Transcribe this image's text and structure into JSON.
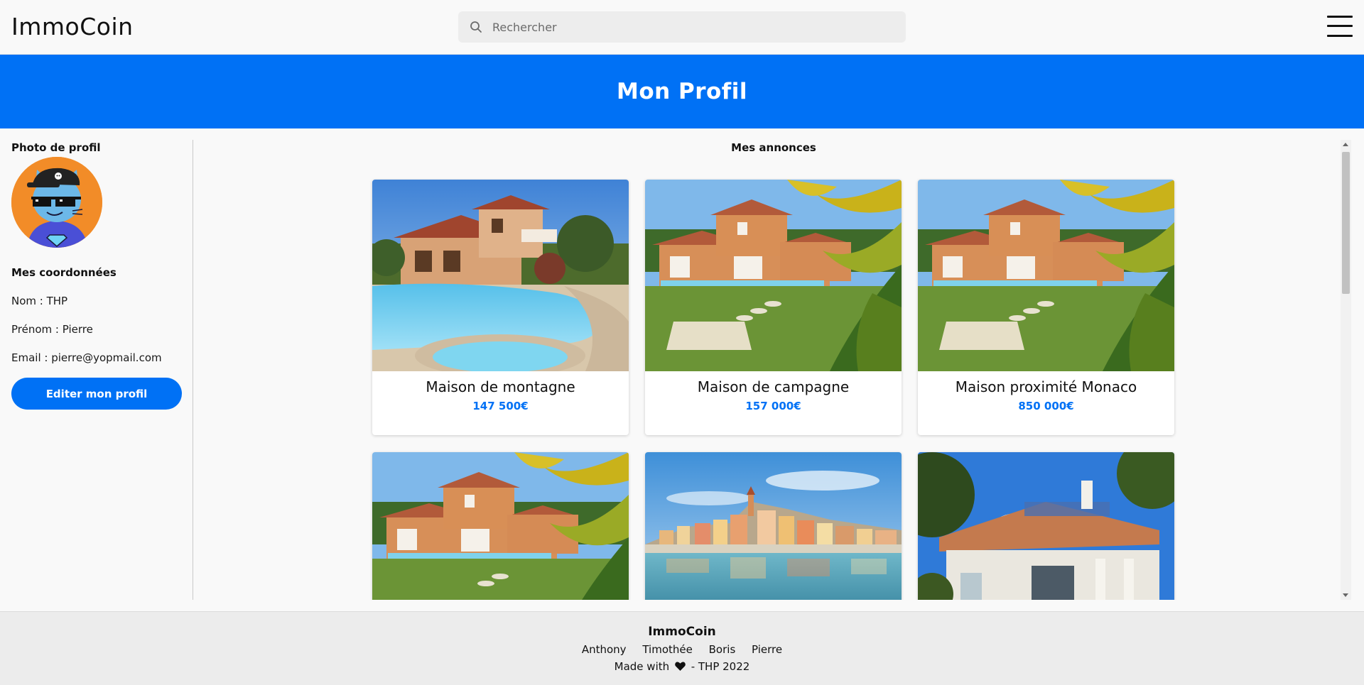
{
  "header": {
    "brand": "ImmoCoin",
    "search_placeholder": "Rechercher",
    "menu_icon": "hamburger-menu-icon"
  },
  "banner": {
    "title": "Mon Profil"
  },
  "sidebar": {
    "photo_heading": "Photo de profil",
    "coords_heading": "Mes coordonnées",
    "nom": "Nom : THP",
    "prenom": "Prénom : Pierre",
    "email": "Email : pierre@yopmail.com",
    "edit_button": "Editer mon profil"
  },
  "main": {
    "title": "Mes annonces",
    "listings": [
      {
        "title": "Maison de montagne",
        "price": "147 500€",
        "image": "villa-pool"
      },
      {
        "title": "Maison de campagne",
        "price": "157 000€",
        "image": "house-garden-palm"
      },
      {
        "title": "Maison proximité Monaco",
        "price": "850 000€",
        "image": "house-garden-palm"
      },
      {
        "title": "",
        "price": "",
        "image": "house-garden-palm"
      },
      {
        "title": "",
        "price": "",
        "image": "coastal-town"
      },
      {
        "title": "",
        "price": "",
        "image": "white-house-terrace"
      }
    ]
  },
  "footer": {
    "brand": "ImmoCoin",
    "authors": [
      "Anthony",
      "Timothée",
      "Boris",
      "Pierre"
    ],
    "made_with_prefix": "Made with",
    "made_with_suffix": "- THP 2022",
    "heart_icon": "heart-icon"
  },
  "colors": {
    "accent": "#0071f5",
    "background": "#f9f9f9",
    "footer_bg": "#ececec"
  }
}
